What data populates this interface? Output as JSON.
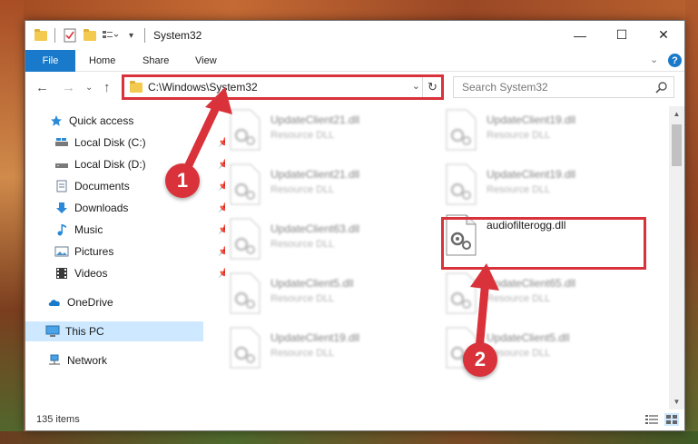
{
  "window": {
    "title": "System32",
    "controls": {
      "minimize": "—",
      "maximize": "☐",
      "close": "✕"
    }
  },
  "ribbon": {
    "file_tab": "File",
    "tabs": [
      "Home",
      "Share",
      "View"
    ],
    "help": "?"
  },
  "address_bar": {
    "path": "C:\\Windows\\System32",
    "search_placeholder": "Search System32"
  },
  "sidebar": {
    "items": [
      {
        "label": "Quick access",
        "icon": "star-icon",
        "pinned": false
      },
      {
        "label": "Local Disk (C:)",
        "icon": "drive-icon",
        "pinned": true
      },
      {
        "label": "Local Disk (D:)",
        "icon": "drive-icon",
        "pinned": true
      },
      {
        "label": "Documents",
        "icon": "documents-icon",
        "pinned": true
      },
      {
        "label": "Downloads",
        "icon": "download-icon",
        "pinned": true
      },
      {
        "label": "Music",
        "icon": "music-icon",
        "pinned": true
      },
      {
        "label": "Pictures",
        "icon": "pictures-icon",
        "pinned": true
      },
      {
        "label": "Videos",
        "icon": "videos-icon",
        "pinned": true
      },
      {
        "label": "OneDrive",
        "icon": "cloud-icon",
        "pinned": false
      },
      {
        "label": "This PC",
        "icon": "computer-icon",
        "pinned": false,
        "selected": true
      },
      {
        "label": "Network",
        "icon": "network-icon",
        "pinned": false
      }
    ]
  },
  "files": [
    {
      "name": "UpdateClient21.dll",
      "type": "Resource DLL"
    },
    {
      "name": "UpdateClient19.dll",
      "type": "Resource DLL"
    },
    {
      "name": "UpdateClient21.dll",
      "type": "Resource DLL"
    },
    {
      "name": "UpdateClient19.dll",
      "type": "Resource DLL"
    },
    {
      "name": "UpdateClient63.dll",
      "type": "Resource DLL"
    },
    {
      "name": "audiofilterogg.dll",
      "type": ""
    },
    {
      "name": "UpdateClient5.dll",
      "type": "Resource DLL"
    },
    {
      "name": "UpdateClient65.dll",
      "type": "Resource DLL"
    },
    {
      "name": "UpdateClient19.dll",
      "type": "Resource DLL"
    },
    {
      "name": "UpdateClient5.dll",
      "type": "Resource DLL"
    }
  ],
  "status": {
    "item_count": "135 items"
  },
  "annotations": {
    "step1": "1",
    "step2": "2"
  },
  "colors": {
    "accent": "#1979ca",
    "highlight": "#d9323a",
    "selected_bg": "#cde8ff"
  }
}
